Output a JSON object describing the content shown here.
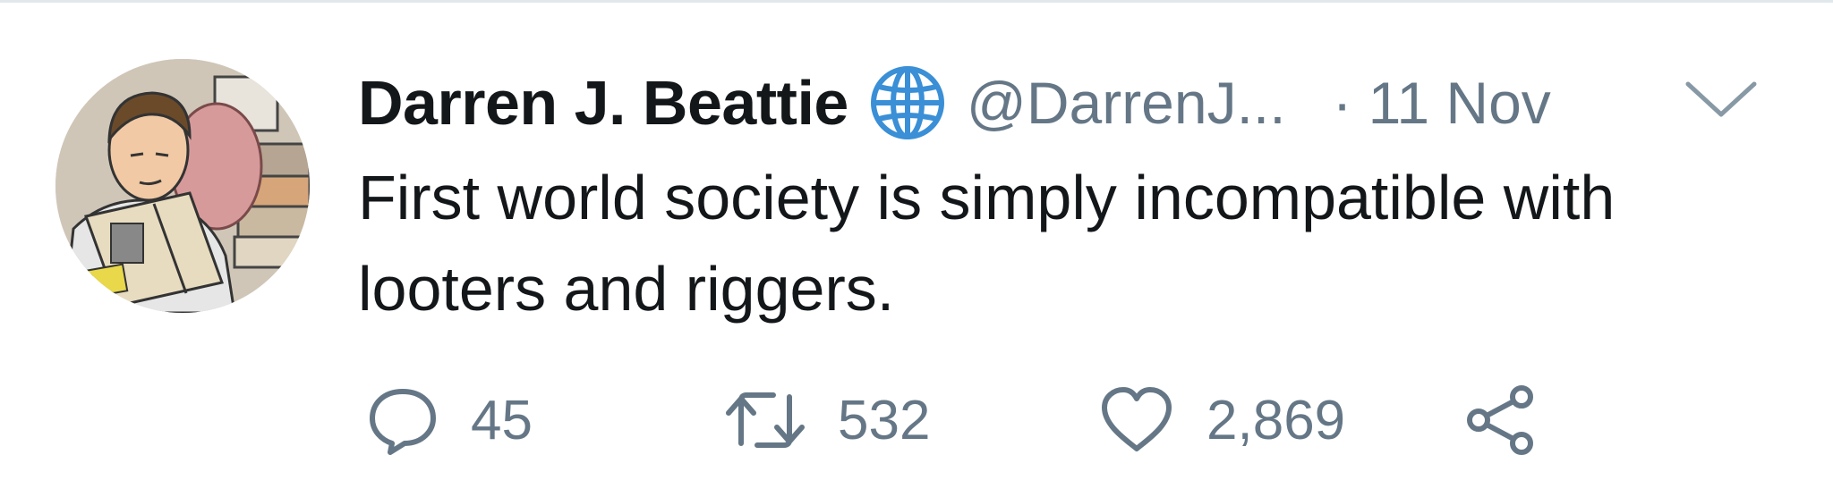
{
  "tweet": {
    "author": {
      "display_name": "Darren J. Beattie",
      "handle": "@DarrenJ...",
      "avatar_icon": "cartoon-avatar",
      "badge_icon": "globe-icon"
    },
    "separator": "·",
    "timestamp": "11 Nov",
    "text": "First world society is simply incompatible with looters and riggers.",
    "menu_icon": "chevron-down-icon",
    "actions": {
      "reply": {
        "icon": "reply-icon",
        "count": "45"
      },
      "retweet": {
        "icon": "retweet-icon",
        "count": "532"
      },
      "like": {
        "icon": "heart-icon",
        "count": "2,869"
      },
      "share": {
        "icon": "share-icon"
      }
    }
  },
  "colors": {
    "text_primary": "#14171a",
    "text_secondary": "#657786",
    "globe_blue": "#3a8fd6",
    "divider": "#e1e8ed"
  }
}
